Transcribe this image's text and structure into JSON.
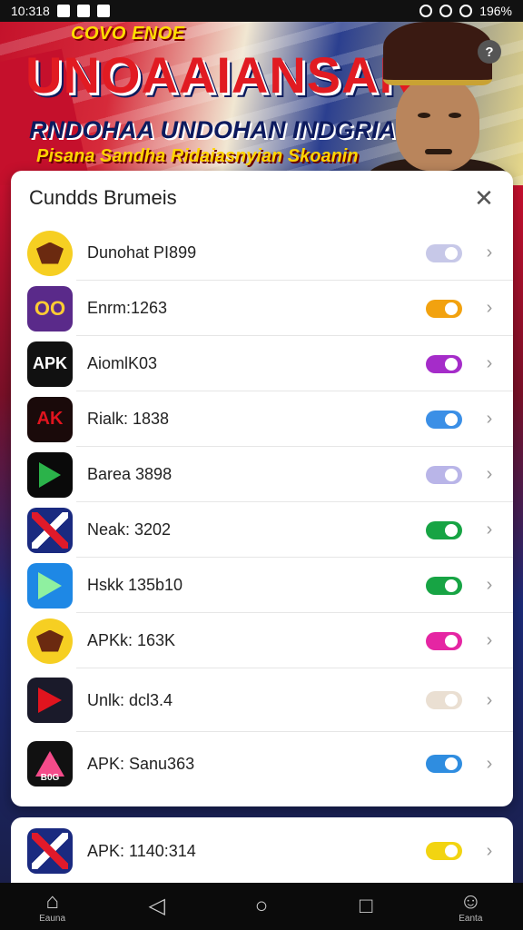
{
  "status_bar": {
    "time": "10:318",
    "battery": "196%"
  },
  "banner": {
    "top_label": "COVO ENOE",
    "title": "UNOAAIANSAN",
    "subtitle": "RNDOHAA UNDOHAN INDGRIAN",
    "tagline": "Pisana Sandha Ridaiasnyian Skoanin",
    "help_glyph": "?"
  },
  "panel": {
    "title": "Cundds Brumeis",
    "close_glyph": "✕",
    "items": [
      {
        "label": "Dunohat PI899",
        "icon": "garuda-icon",
        "toggle_color": "#c7c8e8",
        "icon_text": ""
      },
      {
        "label": "Enrm:1263",
        "icon": "oo-logo-icon",
        "toggle_color": "#f2a20f",
        "icon_text": "OO"
      },
      {
        "label": "AiomlK03",
        "icon": "apk-icon",
        "toggle_color": "#a52cc9",
        "icon_text": "APK"
      },
      {
        "label": "Rialk: 1838",
        "icon": "bonus-icon",
        "toggle_color": "#3b8fe6",
        "icon_text": "AK"
      },
      {
        "label": "Barea 3898",
        "icon": "play-icon",
        "toggle_color": "#b9b5e8",
        "icon_text": ""
      },
      {
        "label": "Neak: 3202",
        "icon": "x-flag-icon",
        "toggle_color": "#17a444",
        "icon_text": ""
      },
      {
        "label": "Hskk 135b10",
        "icon": "google-play-icon",
        "toggle_color": "#17a444",
        "icon_text": ""
      },
      {
        "label": "APKk: 163K",
        "icon": "garuda-icon",
        "toggle_color": "#e525a3",
        "icon_text": ""
      },
      {
        "label": "Unlk: dcl3.4",
        "icon": "flag-play-icon",
        "toggle_color": "#eadfd2",
        "icon_text": ""
      },
      {
        "label": "APK: Sanu363",
        "icon": "rainbow-icon",
        "toggle_color": "#2f8de0",
        "icon_text": "B0G"
      }
    ]
  },
  "card2": {
    "label": "APK: 1140:314",
    "toggle_color": "#f2d411"
  },
  "chevron": "›",
  "navbar": {
    "home_label": "Eauna",
    "back_glyph": "◁",
    "home_glyph": "○",
    "recent_glyph": "□",
    "profile_label": "Eanta"
  }
}
